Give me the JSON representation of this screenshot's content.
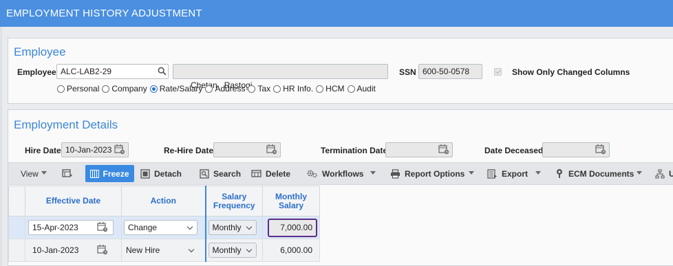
{
  "window": {
    "title": "EMPLOYMENT HISTORY ADJUSTMENT"
  },
  "employee": {
    "section_title": "Employee",
    "employee_label": "Employee",
    "employee_value": "ALC-LAB2-29",
    "name_value": "Chetan   Rastogi",
    "ssn_label": "SSN",
    "ssn_value": "600-50-0578",
    "show_changed_label": "Show Only Changed Columns",
    "show_changed_checked": true,
    "radios": [
      "Personal",
      "Company",
      "Rate/Salary",
      "Address",
      "Tax",
      "HR Info.",
      "HCM",
      "Audit"
    ],
    "selected_radio": "Rate/Salary"
  },
  "details": {
    "section_title": "Employment Details",
    "hire_date_label": "Hire Date",
    "hire_date_value": "10-Jan-2023",
    "rehire_date_label": "Re-Hire Date",
    "rehire_date_value": "",
    "termination_date_label": "Termination Date",
    "termination_date_value": "",
    "date_deceased_label": "Date Deceased",
    "date_deceased_value": ""
  },
  "toolbar": {
    "view": "View",
    "freeze": "Freeze",
    "detach": "Detach",
    "search": "Search",
    "delete": "Delete",
    "workflows": "Workflows",
    "report_options": "Report Options",
    "export": "Export",
    "ecm_documents": "ECM Documents",
    "truncated": "U"
  },
  "grid": {
    "headers": [
      "Effective Date",
      "Action",
      "Salary Frequency",
      "Monthly Salary"
    ],
    "header_lines": [
      [
        "Effective Date"
      ],
      [
        "Action"
      ],
      [
        "Salary",
        "Frequency"
      ],
      [
        "Monthly",
        "Salary"
      ]
    ],
    "rows": [
      {
        "effective_date": "15-Apr-2023",
        "action": "Change",
        "frequency": "Monthly",
        "salary": "7,000.00"
      },
      {
        "effective_date": "10-Jan-2023",
        "action": "New Hire",
        "frequency": "Monthly",
        "salary": "6,000.00"
      }
    ]
  },
  "colors": {
    "title_bar": "#4a8fe0",
    "accent": "#3b86d8",
    "highlight_border": "#5a2e8a"
  }
}
